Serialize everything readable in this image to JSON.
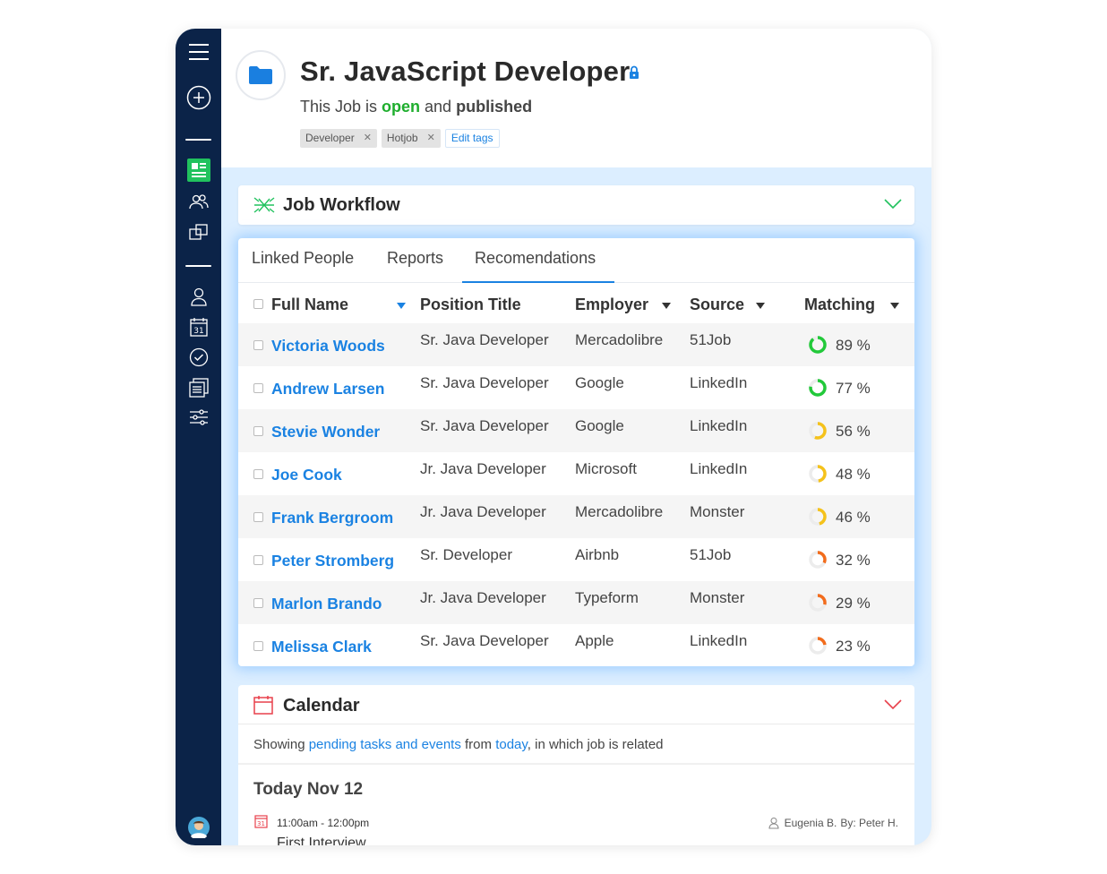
{
  "job": {
    "title": "Sr. JavaScript Developer",
    "status_prefix": "This Job is ",
    "status_open": "open",
    "status_mid": " and ",
    "status_published": "published",
    "tags": [
      "Developer",
      "Hotjob"
    ],
    "edit_tags": "Edit tags"
  },
  "workflow": {
    "title": "Job Workflow"
  },
  "tabs": [
    "Linked People",
    "Reports",
    "Recomendations"
  ],
  "active_tab": "Recomendations",
  "table": {
    "columns": [
      "Full Name",
      "Position Title",
      "Employer",
      "Source",
      "Matching"
    ],
    "rows": [
      {
        "name": "Victoria Woods",
        "position": "Sr. Java Developer",
        "employer": "Mercadolibre",
        "source": "51Job",
        "matching": "89 %",
        "match_value": 0.89
      },
      {
        "name": "Andrew Larsen",
        "position": "Sr. Java Developer",
        "employer": "Google",
        "source": "LinkedIn",
        "matching": "77 %",
        "match_value": 0.77
      },
      {
        "name": "Stevie Wonder",
        "position": "Sr. Java Developer",
        "employer": "Google",
        "source": "LinkedIn",
        "matching": "56 %",
        "match_value": 0.56
      },
      {
        "name": "Joe Cook",
        "position": "Jr. Java Developer",
        "employer": "Microsoft",
        "source": "LinkedIn",
        "matching": "48 %",
        "match_value": 0.48
      },
      {
        "name": "Frank Bergroom",
        "position": "Jr. Java Developer",
        "employer": "Mercadolibre",
        "source": "Monster",
        "matching": "46 %",
        "match_value": 0.46
      },
      {
        "name": "Peter Stromberg",
        "position": "Sr. Developer",
        "employer": "Airbnb",
        "source": "51Job",
        "matching": "32 %",
        "match_value": 0.32
      },
      {
        "name": "Marlon Brando",
        "position": "Jr. Java Developer",
        "employer": "Typeform",
        "source": "Monster",
        "matching": "29 %",
        "match_value": 0.29
      },
      {
        "name": "Melissa Clark",
        "position": "Sr. Java Developer",
        "employer": "Apple",
        "source": "LinkedIn",
        "matching": "23 %",
        "match_value": 0.23
      }
    ]
  },
  "calendar": {
    "title": "Calendar",
    "info_prefix": "Showing ",
    "info_link1": "pending tasks and events",
    "info_mid": " from ",
    "info_link2": "today",
    "info_suffix": ", in which job is related",
    "day": "Today Nov 12",
    "event": {
      "time": "11:00am - 12:00pm",
      "assignee": "Eugenia B.",
      "by": "By: Peter H.",
      "title": "First Interview"
    }
  },
  "colors": {
    "sidebar": "#0b2348",
    "accent": "#1a82e2",
    "open": "#1fae2e",
    "match_high": "#22c93a",
    "match_mid": "#f5c21b",
    "match_low": "#f26c1c"
  },
  "icons": [
    "menu-icon",
    "add-icon",
    "jobs-board-icon",
    "people-icon",
    "companies-icon",
    "contact-icon",
    "calendar-icon",
    "tasks-icon",
    "reports-icon",
    "settings-icon",
    "avatar"
  ]
}
